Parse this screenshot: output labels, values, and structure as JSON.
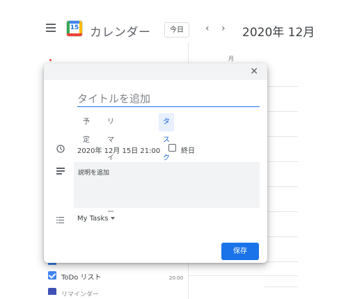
{
  "header": {
    "app_title": "カレンダー",
    "logo_number": "15",
    "today_button": "今日",
    "prev_icon": "chevron-left-icon",
    "next_icon": "chevron-right-icon",
    "date_title": "2020年 12月"
  },
  "calendar": {
    "day_label": "月",
    "time_label": "20:00"
  },
  "sidebar": {
    "todo_label": "ToDo リスト",
    "reminder_label": "リマインダー"
  },
  "dialog": {
    "close_icon": "close-icon",
    "title_placeholder": "タイトルを追加",
    "tabs": [
      {
        "label": "予定"
      },
      {
        "label": "リマインダー"
      },
      {
        "label": "タスク",
        "active": true
      }
    ],
    "date_text": "2020年 12月 15日   21:00",
    "allday_label": "終日",
    "description_placeholder": "説明を追加",
    "task_list": "My Tasks",
    "save_label": "保存"
  },
  "colors": {
    "accent": "#1a73e8",
    "active_tab_bg": "#e8f0fe"
  }
}
